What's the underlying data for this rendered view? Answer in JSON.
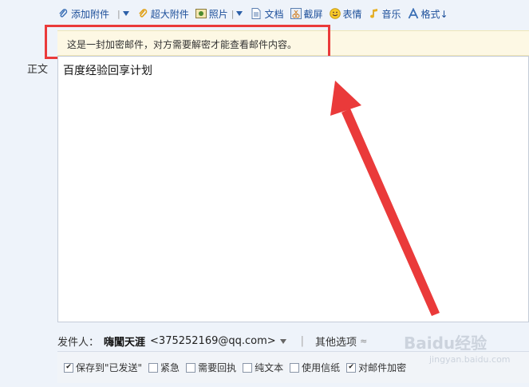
{
  "toolbar": {
    "attach": "添加附件",
    "big_attach": "超大附件",
    "photo": "照片",
    "doc": "文档",
    "screenshot": "截屏",
    "emoji": "表情",
    "music": "音乐",
    "format": "格式↓"
  },
  "notice": {
    "text": "这是一封加密邮件，对方需要解密才能查看邮件内容。"
  },
  "editor": {
    "label": "正文",
    "content": "百度经验回享计划"
  },
  "sender": {
    "label": "发件人：",
    "name": "嗨闖天涯",
    "email": "<375252169@qq.com>",
    "other_options": "其他选项"
  },
  "options": {
    "save_sent": "保存到\"已发送\"",
    "urgent": "紧急",
    "receipt": "需要回执",
    "plain_text": "纯文本",
    "stationery": "使用信纸",
    "encrypt": "对邮件加密"
  },
  "watermark": {
    "brand": "Baidu经验",
    "url": "jingyan.baidu.com"
  },
  "colors": {
    "highlight": "#ea3a3a",
    "link": "#1d4f9a"
  }
}
